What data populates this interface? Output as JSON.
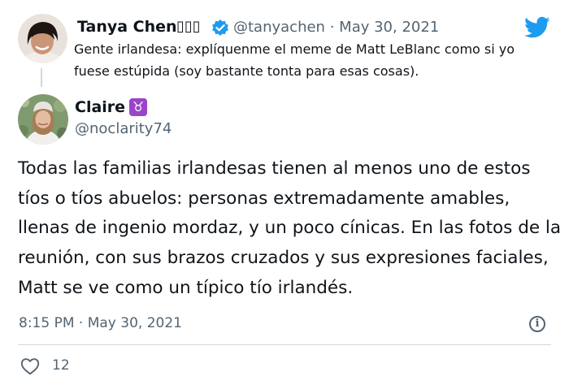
{
  "quoted_tweet": {
    "author_name": "Tanya Chen",
    "name_emoji": "▯▯▯",
    "handle": "@tanyachen",
    "separator": "·",
    "date": "May 30, 2021",
    "text": "Gente irlandesa: explíquenme el meme de Matt LeBlanc como si yo fuese estúpida (soy bastante tonta para esas cosas)."
  },
  "main_tweet": {
    "author_name": "Claire",
    "name_emoji": "♉",
    "handle": "@noclarity74",
    "text": "Todas las familias irlandesas tienen al menos uno de estos tíos o tíos abuelos: personas extremadamente amables, llenas de ingenio mordaz, y un poco cínicas. En las fotos de la reunión, con sus brazos cruzados y sus expresiones faciales, Matt se ve como un típico tío irlandés.",
    "time": "8:15 PM",
    "separator": "·",
    "date": "May 30, 2021",
    "likes": "12"
  },
  "icons": {
    "brand": "twitter-bird-icon",
    "verified": "verified-badge-icon",
    "info": "info-icon",
    "like": "heart-icon"
  },
  "colors": {
    "brand_blue": "#1d9bf0",
    "zodiac_purple": "#9b44c9",
    "muted_text": "#536471",
    "divider": "#cfd9de"
  }
}
